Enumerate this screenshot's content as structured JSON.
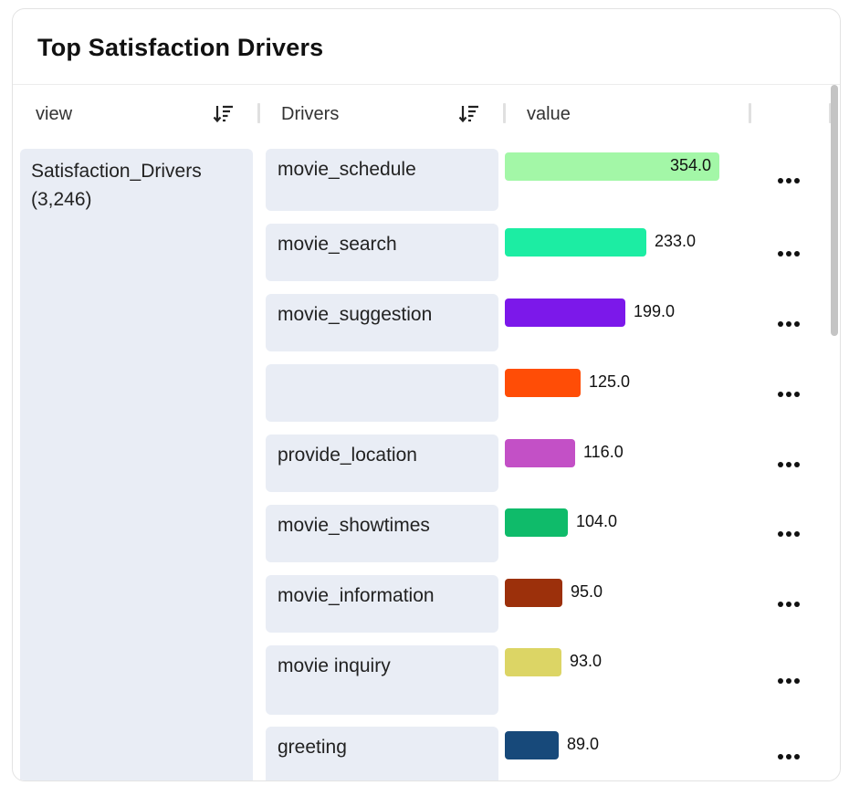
{
  "title": "Top Satisfaction Drivers",
  "columns": {
    "view": "view",
    "drivers": "Drivers",
    "value": "value"
  },
  "view_cell": {
    "name": "Satisfaction_Drivers",
    "count": "(3,246)"
  },
  "chart_data": {
    "type": "bar",
    "orientation": "horizontal",
    "categories": [
      "movie_schedule",
      "movie_search",
      "movie_suggestion",
      "",
      "provide_location",
      "movie_showtimes",
      "movie_information",
      "movie inquiry",
      "greeting"
    ],
    "values": [
      354.0,
      233.0,
      199.0,
      125.0,
      116.0,
      104.0,
      95.0,
      93.0,
      89.0
    ],
    "value_labels": [
      "354.0",
      "233.0",
      "199.0",
      "125.0",
      "116.0",
      "104.0",
      "95.0",
      "93.0",
      "89.0"
    ],
    "colors": [
      "#a3f7a7",
      "#1ceda3",
      "#7c18ea",
      "#ff4d06",
      "#c350c6",
      "#0fbb6a",
      "#9c300b",
      "#dcd565",
      "#17497a"
    ],
    "xlim": [
      0,
      354
    ]
  },
  "icons": {
    "sort": "sort-descending-icon",
    "more": "more-horizontal-icon"
  }
}
